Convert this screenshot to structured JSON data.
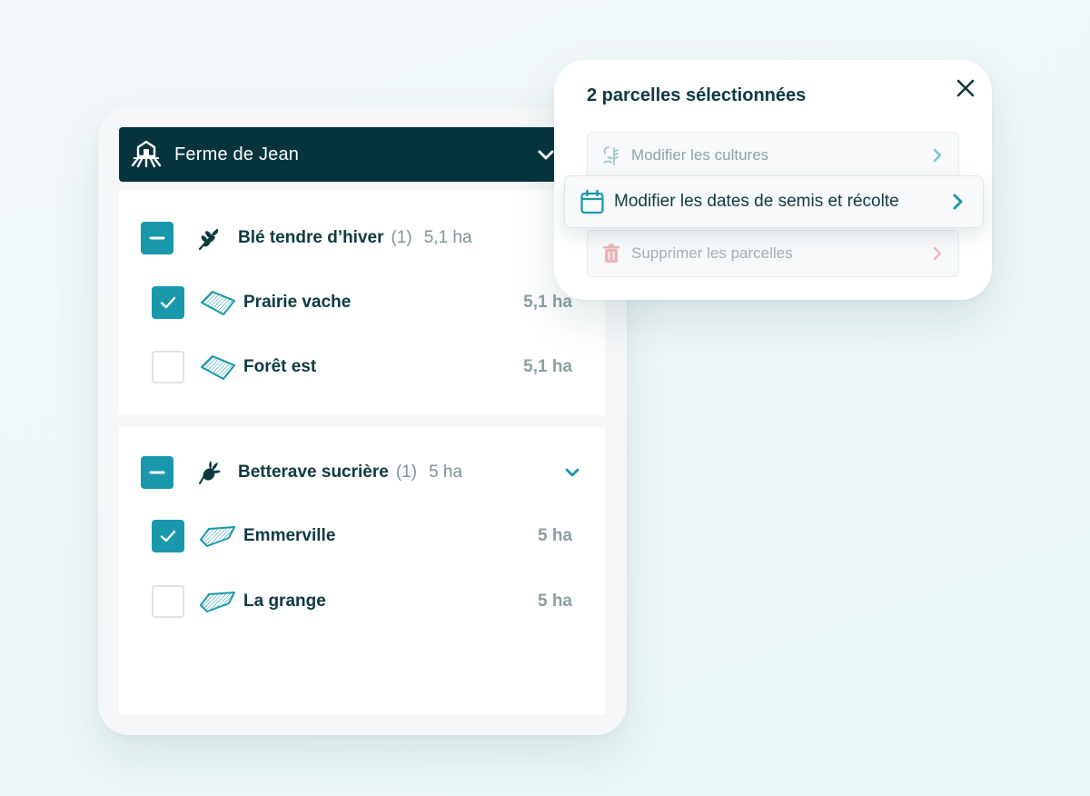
{
  "farm": {
    "name": "Ferme de Jean"
  },
  "groups": [
    {
      "crop": "Blé tendre d’hiver",
      "count": "(1)",
      "area": "5,1 ha",
      "parcels": [
        {
          "name": "Prairie vache",
          "area": "5,1 ha",
          "checked": true
        },
        {
          "name": "Forêt est",
          "area": "5,1 ha",
          "checked": false
        }
      ]
    },
    {
      "crop": "Betterave sucrière",
      "count": "(1)",
      "area": "5 ha",
      "parcels": [
        {
          "name": "Emmerville",
          "area": "5 ha",
          "checked": true
        },
        {
          "name": "La grange",
          "area": "5 ha",
          "checked": false
        }
      ]
    }
  ],
  "popup": {
    "title": "2 parcelles sélectionnées",
    "actions": [
      {
        "label": "Modifier les cultures",
        "icon": "crops-icon"
      },
      {
        "label": "Modifier les dates de semis et récolte",
        "icon": "calendar-icon"
      },
      {
        "label": "Supprimer les parcelles",
        "icon": "trash-icon"
      }
    ]
  },
  "colors": {
    "header": "#05343c",
    "accent": "#1998ab",
    "danger": "#e7a4a4"
  }
}
